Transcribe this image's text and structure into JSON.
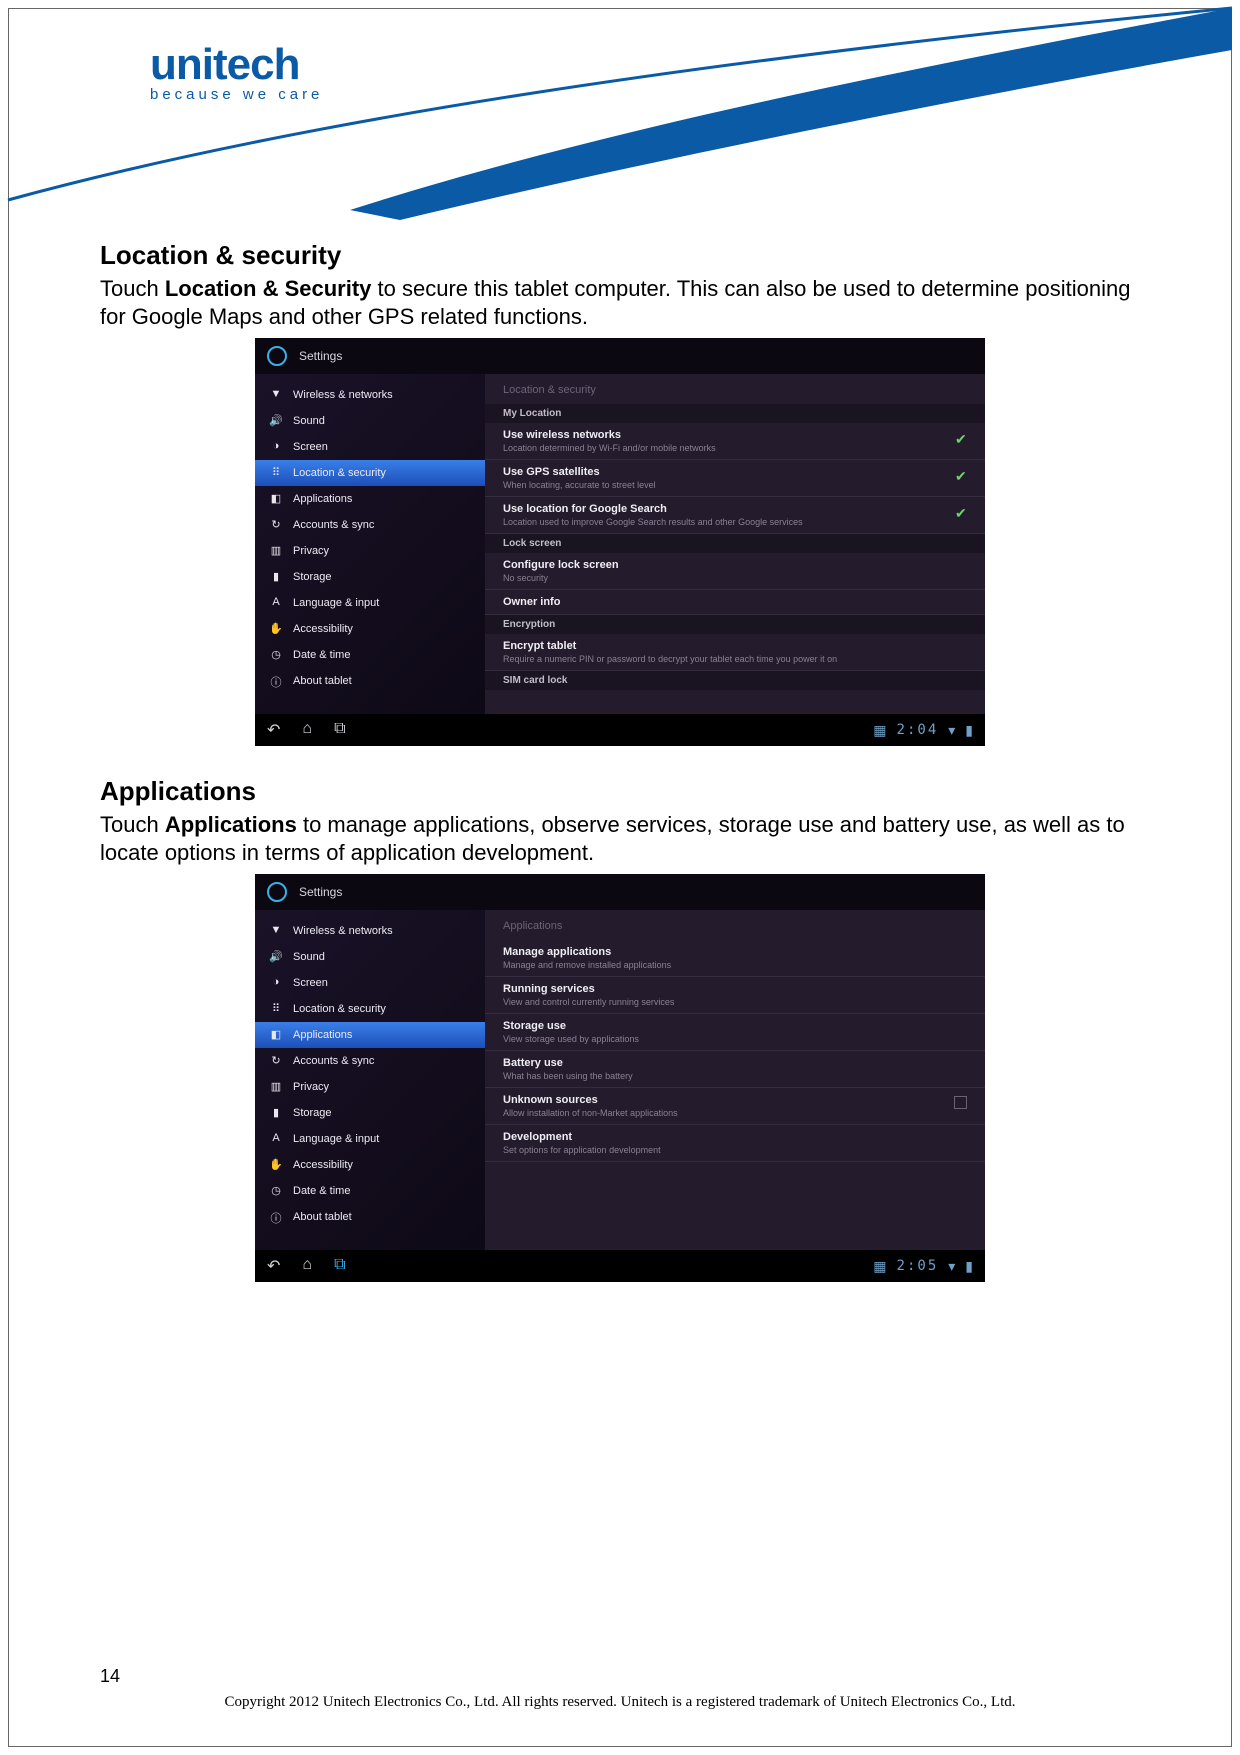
{
  "logo": {
    "brand": "unitech",
    "tagline": "because we care"
  },
  "page_number": "14",
  "copyright": "Copyright 2012 Unitech Electronics Co., Ltd. All rights reserved. Unitech is a registered trademark of Unitech Electronics Co., Ltd.",
  "sections": {
    "loc": {
      "title": "Location & security",
      "body_pre": "Touch ",
      "body_bold": "Location & Security",
      "body_post": " to secure this tablet computer. This can also be used to determine positioning for Google Maps and other GPS related functions."
    },
    "apps": {
      "title": "Applications",
      "body_pre": "Touch ",
      "body_bold": "Applications",
      "body_post": " to manage applications, observe services, storage use and battery use, as well as to locate options in terms of application development."
    }
  },
  "settings_label": "Settings",
  "sidebar_items": [
    {
      "icon": "▼",
      "label": "Wireless & networks"
    },
    {
      "icon": "🔊",
      "label": "Sound"
    },
    {
      "icon": "◑",
      "label": "Screen"
    },
    {
      "icon": "⠿",
      "label": "Location & security"
    },
    {
      "icon": "◧",
      "label": "Applications"
    },
    {
      "icon": "↻",
      "label": "Accounts & sync"
    },
    {
      "icon": "▥",
      "label": "Privacy"
    },
    {
      "icon": "▮",
      "label": "Storage"
    },
    {
      "icon": "A",
      "label": "Language & input"
    },
    {
      "icon": "✋",
      "label": "Accessibility"
    },
    {
      "icon": "◷",
      "label": "Date & time"
    },
    {
      "icon": "ⓘ",
      "label": "About tablet"
    }
  ],
  "screenshot1": {
    "panel_title": "Location & security",
    "time": "2:04",
    "groups": [
      {
        "header": "My Location",
        "rows": [
          {
            "title": "Use wireless networks",
            "sub": "Location determined by Wi-Fi and/or mobile networks",
            "check": true
          },
          {
            "title": "Use GPS satellites",
            "sub": "When locating, accurate to street level",
            "check": true
          },
          {
            "title": "Use location for Google Search",
            "sub": "Location used to improve Google Search results and other Google services",
            "check": true
          }
        ]
      },
      {
        "header": "Lock screen",
        "rows": [
          {
            "title": "Configure lock screen",
            "sub": "No security"
          },
          {
            "title": "Owner info",
            "sub": ""
          }
        ]
      },
      {
        "header": "Encryption",
        "rows": [
          {
            "title": "Encrypt tablet",
            "sub": "Require a numeric PIN or password to decrypt your tablet each time you power it on"
          }
        ]
      },
      {
        "header": "SIM card lock",
        "rows": []
      }
    ]
  },
  "screenshot2": {
    "panel_title": "Applications",
    "time": "2:05",
    "rows": [
      {
        "title": "Manage applications",
        "sub": "Manage and remove installed applications"
      },
      {
        "title": "Running services",
        "sub": "View and control currently running services"
      },
      {
        "title": "Storage use",
        "sub": "View storage used by applications"
      },
      {
        "title": "Battery use",
        "sub": "What has been using the battery"
      },
      {
        "title": "Unknown sources",
        "sub": "Allow installation of non-Market applications",
        "checkbox": true
      },
      {
        "title": "Development",
        "sub": "Set options for application development"
      }
    ]
  }
}
